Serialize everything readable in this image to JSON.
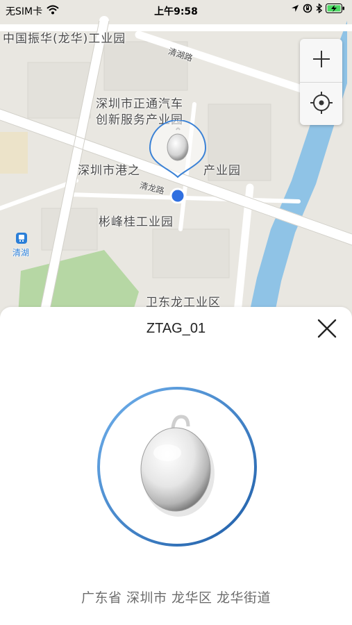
{
  "status_bar": {
    "carrier": "无SIM卡",
    "time": "上午9:58",
    "icons": [
      "wifi-icon",
      "location-arrow-icon",
      "orientation-lock-icon",
      "bluetooth-icon",
      "battery-charging-icon"
    ]
  },
  "map": {
    "labels": {
      "industrial_park_zhenhua": "中国振华(龙华)工业园",
      "qinghu_road": "清湖路",
      "auto_park_line1": "深圳市正通汽车",
      "auto_park_line2": "创新服务产业园",
      "gangzhi_park": "深圳市港之",
      "gangzhi_park_tail": "产业园",
      "qinglong_road": "清龙路",
      "binfenggui_park": "彬峰桂工业园",
      "metro_station": "清湖",
      "weidonglong_zone": "卫东龙工业区"
    },
    "controls": {
      "zoom_in": "plus-icon",
      "locate": "locate-crosshair-icon"
    },
    "colors": {
      "land": "#e9e7e1",
      "road": "#ffffff",
      "river": "#8fc3e6",
      "green": "#b6d7a4",
      "marker_blue": "#2f6fe0"
    }
  },
  "sheet": {
    "title": "ZTAG_01",
    "address": "广东省 深圳市 龙华区 龙华街道",
    "close_icon": "close-icon"
  }
}
